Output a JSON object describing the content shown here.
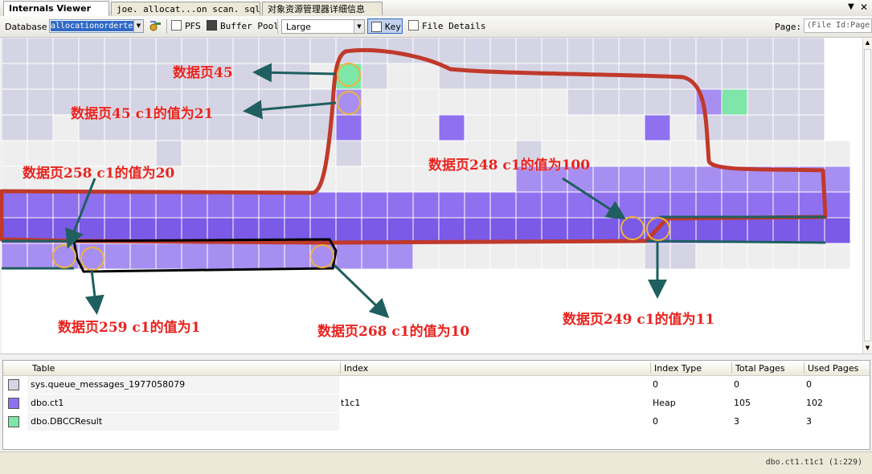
{
  "tabs": [
    {
      "label": "Internals Viewer",
      "active": true
    },
    {
      "label": "joe. allocat...on scan. sql*",
      "active": false
    },
    {
      "label": "对象资源管理器详细信息",
      "active": false
    }
  ],
  "tab_controls": {
    "menu_icon": "dropdown-arrow-icon",
    "close_icon": "close-icon",
    "menu_glyph": "▼",
    "close_glyph": "✕"
  },
  "toolbar": {
    "database_label": "Database",
    "database_value": "allocationorderte",
    "pfs_label": "PFS",
    "buffer_pool_label": "Buffer Pool",
    "size_value": "Large",
    "key_label": "Key",
    "file_details_label": "File Details",
    "page_label": "Page:",
    "page_placeholder": "(File Id:Page)"
  },
  "colors": {
    "heap": "#8f71f0",
    "heap_dark": "#7a5ae6",
    "heap_light": "#a78ff2",
    "dbccresult": "#7ee6a8",
    "queue": "#d5d4e4",
    "empty": "#eeeeee",
    "annotation": "#e8231e",
    "red_outline": "#c0392b",
    "teal_arrow": "#1f5f5f"
  },
  "allocation_map": {
    "columns": 32,
    "rows": 9,
    "row_legend": "D=dbo.DBCCResult H=dbo.ct1 h=dbo.ct1(light) Q=sys.queue_messages .=empty",
    "cells": [
      "QQQQQQQQQQQQQQQQQQQQQQQQQQQQQQQQ",
      "QQQQQQQQQQQQ.DQ..QQQQQQQQQQQQQQQ",
      "QQQQQQQQQQQQQH........QQQQQHDQQQ",
      "QQ.QQQQQQQQQQH...H.......H.QQQQQ",
      "......Q......Q......Q............",
      "....................HHHHHHHHHHHHH",
      "HHHHHHHHHHHHHHHHHHHHHHHHHHHHHHHHH",
      "HHHHHHHHHHHHHHHHHHHHHHHHHHHHHHHHH",
      "HHHHHHHHHHHHHHHH.........QQ......"
    ]
  },
  "annotations": [
    {
      "text": "数据页45"
    },
    {
      "text": "数据页45  c1的值为21"
    },
    {
      "text": "数据页258  c1的值为20"
    },
    {
      "text": "数据页248  c1的值为100"
    },
    {
      "text": "数据页259  c1的值为1"
    },
    {
      "text": "数据页268  c1的值为10"
    },
    {
      "text": "数据页249  c1的值为11"
    }
  ],
  "legend": {
    "headers": [
      "Table",
      "Index",
      "Index Type",
      "Total Pages",
      "Used Pages"
    ],
    "rows": [
      {
        "color": "#d5d4e4",
        "table": "sys.queue_messages_1977058079",
        "index": "",
        "index_type": "0",
        "total_pages": "0",
        "used_pages": "0"
      },
      {
        "color": "#8f71f0",
        "table": "dbo.ct1",
        "index": "t1c1",
        "index_type": "Heap",
        "total_pages": "105",
        "used_pages": "102"
      },
      {
        "color": "#7ee6a8",
        "table": "dbo.DBCCResult",
        "index": "",
        "index_type": "0",
        "total_pages": "3",
        "used_pages": "3"
      }
    ]
  },
  "status": {
    "text": "dbo.ct1.t1c1 (1:229)"
  }
}
